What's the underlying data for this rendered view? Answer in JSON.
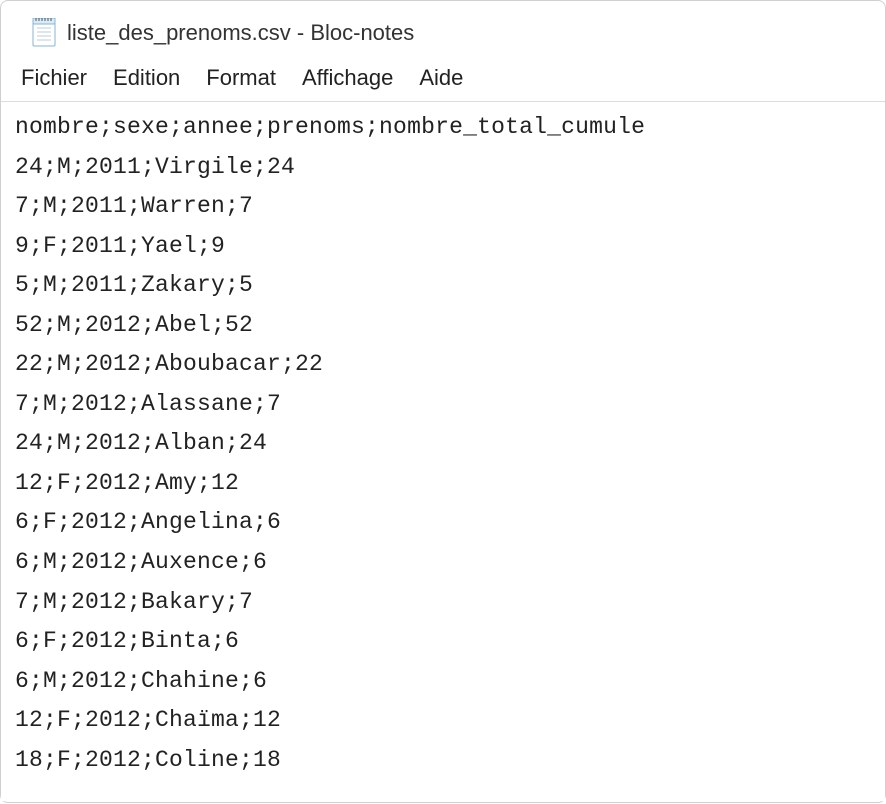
{
  "window": {
    "title": "liste_des_prenoms.csv - Bloc-notes"
  },
  "menu": {
    "items": [
      {
        "label": "Fichier"
      },
      {
        "label": "Edition"
      },
      {
        "label": "Format"
      },
      {
        "label": "Affichage"
      },
      {
        "label": "Aide"
      }
    ]
  },
  "content": "nombre;sexe;annee;prenoms;nombre_total_cumule\n24;M;2011;Virgile;24\n7;M;2011;Warren;7\n9;F;2011;Yael;9\n5;M;2011;Zakary;5\n52;M;2012;Abel;52\n22;M;2012;Aboubacar;22\n7;M;2012;Alassane;7\n24;M;2012;Alban;24\n12;F;2012;Amy;12\n6;F;2012;Angelina;6\n6;M;2012;Auxence;6\n7;M;2012;Bakary;7\n6;F;2012;Binta;6\n6;M;2012;Chahine;6\n12;F;2012;Chaïma;12\n18;F;2012;Coline;18"
}
